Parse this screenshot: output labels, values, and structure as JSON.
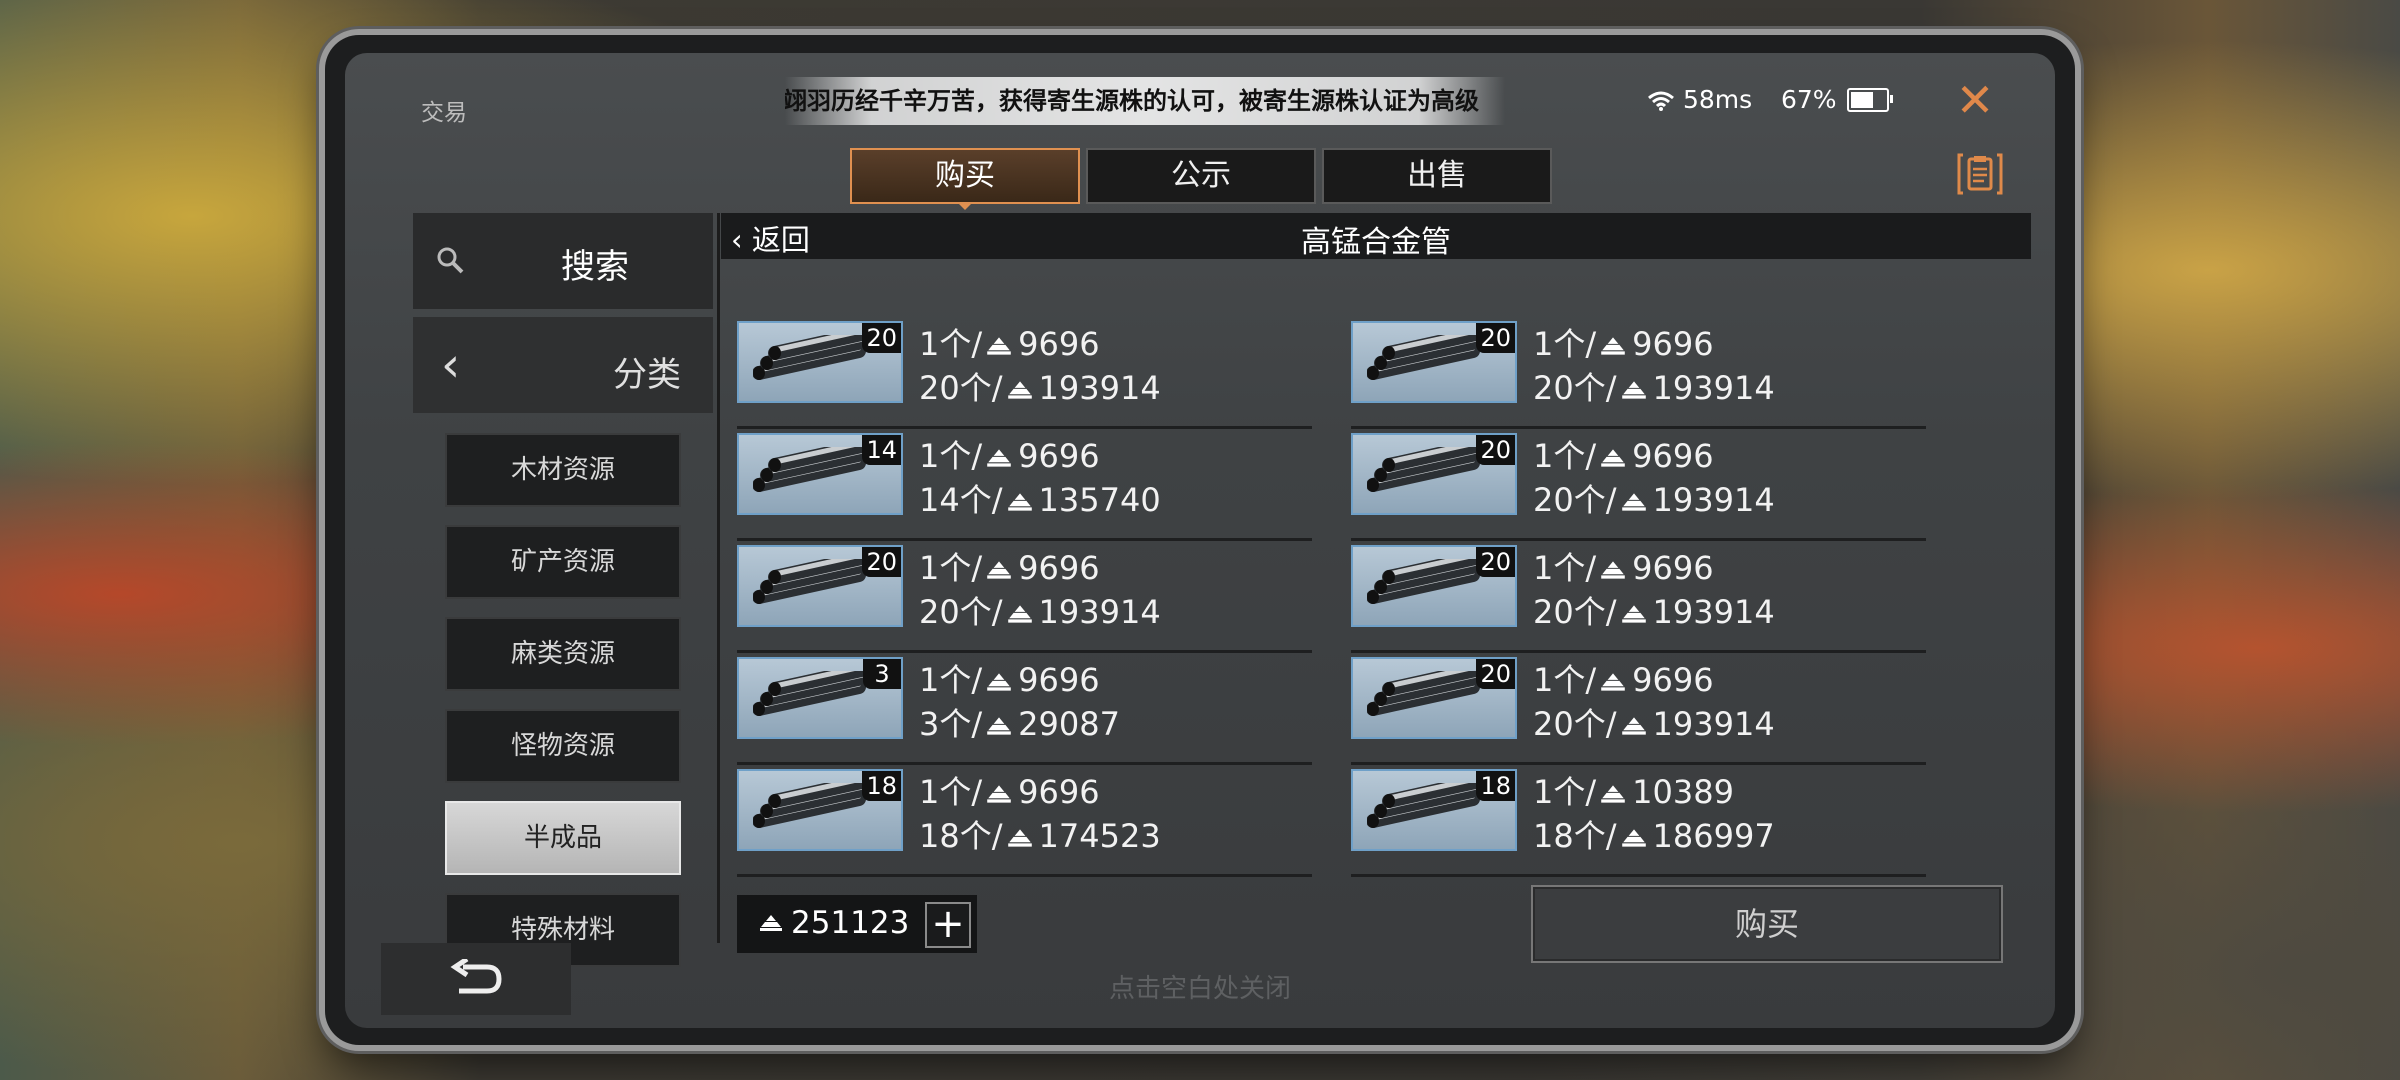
{
  "window": {
    "app_title": "交易",
    "marquee": "翊羽历经千辛万苦，获得寄生源株的认可，被寄生源株认证为高级",
    "ping": "58ms",
    "battery": "67%",
    "battery_fraction": 0.67
  },
  "tabs": [
    {
      "label": "购买",
      "active": true
    },
    {
      "label": "公示",
      "active": false
    },
    {
      "label": "出售",
      "active": false
    }
  ],
  "sidebar": {
    "search_label": "搜索",
    "category_label": "分类",
    "categories": [
      "木材资源",
      "矿产资源",
      "麻类资源",
      "怪物资源",
      "半成品",
      "特殊材料"
    ],
    "active_category": "半成品"
  },
  "item": {
    "back_label": "返回",
    "title": "高锰合金管"
  },
  "listings": [
    {
      "qty": "20",
      "unit_label": "1个/",
      "unit_price": "9696",
      "total_label": "20个/",
      "total_price": "193914"
    },
    {
      "qty": "20",
      "unit_label": "1个/",
      "unit_price": "9696",
      "total_label": "20个/",
      "total_price": "193914"
    },
    {
      "qty": "14",
      "unit_label": "1个/",
      "unit_price": "9696",
      "total_label": "14个/",
      "total_price": "135740"
    },
    {
      "qty": "20",
      "unit_label": "1个/",
      "unit_price": "9696",
      "total_label": "20个/",
      "total_price": "193914"
    },
    {
      "qty": "20",
      "unit_label": "1个/",
      "unit_price": "9696",
      "total_label": "20个/",
      "total_price": "193914"
    },
    {
      "qty": "20",
      "unit_label": "1个/",
      "unit_price": "9696",
      "total_label": "20个/",
      "total_price": "193914"
    },
    {
      "qty": "3",
      "unit_label": "1个/",
      "unit_price": "9696",
      "total_label": "3个/",
      "total_price": "29087"
    },
    {
      "qty": "20",
      "unit_label": "1个/",
      "unit_price": "9696",
      "total_label": "20个/",
      "total_price": "193914"
    },
    {
      "qty": "18",
      "unit_label": "1个/",
      "unit_price": "9696",
      "total_label": "18个/",
      "total_price": "174523"
    },
    {
      "qty": "18",
      "unit_label": "1个/",
      "unit_price": "10389",
      "total_label": "18个/",
      "total_price": "186997"
    }
  ],
  "wallet": {
    "amount": "251123"
  },
  "buy_button": "购买",
  "footer_hint": "点击空白处关闭",
  "colors": {
    "accent": "#e08a4a",
    "thumb_border": "#6fa0c8"
  },
  "icons": {
    "search": "search-icon",
    "back": "chevron-left-icon",
    "close": "close-icon",
    "clipboard": "clipboard-icon",
    "currency": "currency-icon",
    "undo": "undo-icon",
    "wifi": "wifi-icon",
    "battery": "battery-icon"
  }
}
